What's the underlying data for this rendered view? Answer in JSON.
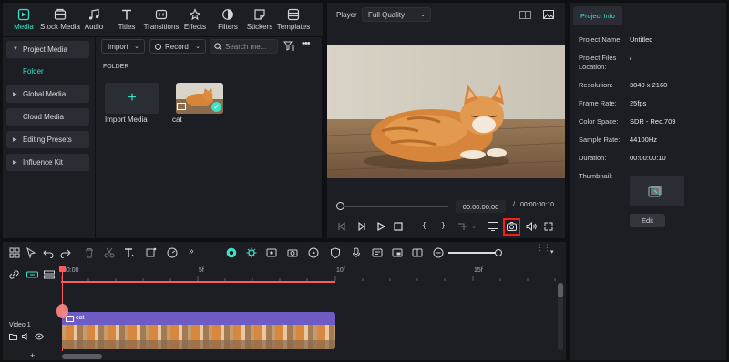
{
  "top_tabs": [
    {
      "label": "Media",
      "icon": "media-icon"
    },
    {
      "label": "Stock Media",
      "icon": "stock-media-icon"
    },
    {
      "label": "Audio",
      "icon": "music-note-icon"
    },
    {
      "label": "Titles",
      "icon": "titles-icon"
    },
    {
      "label": "Transitions",
      "icon": "transitions-icon"
    },
    {
      "label": "Effects",
      "icon": "effects-icon"
    },
    {
      "label": "Filters",
      "icon": "filters-icon"
    },
    {
      "label": "Stickers",
      "icon": "stickers-icon"
    },
    {
      "label": "Templates",
      "icon": "templates-icon"
    }
  ],
  "sidebar": {
    "items": [
      {
        "label": "Project Media"
      },
      {
        "label": "Folder"
      },
      {
        "label": "Global Media"
      },
      {
        "label": "Cloud Media"
      },
      {
        "label": "Editing Presets"
      },
      {
        "label": "Influence Kit"
      }
    ]
  },
  "media": {
    "import_label": "Import",
    "record_label": "Record",
    "search_placeholder": "Search me...",
    "folder_heading": "FOLDER",
    "import_tile_label": "Import Media",
    "clip_label": "cat"
  },
  "player": {
    "label": "Player",
    "quality": "Full Quality",
    "current_time": "00:00:00:00",
    "separator": "/",
    "total_time": "00:00:00:10",
    "progress": 0
  },
  "info": {
    "tab": "Project Info",
    "rows": [
      {
        "label": "Project Name:",
        "value": "Untitled"
      },
      {
        "label": "Project Files Location:",
        "value": "/"
      },
      {
        "label": "Resolution:",
        "value": "3840 x 2160"
      },
      {
        "label": "Frame Rate:",
        "value": "25fps"
      },
      {
        "label": "Color Space:",
        "value": "SDR - Rec.709"
      },
      {
        "label": "Sample Rate:",
        "value": "44100Hz"
      },
      {
        "label": "Duration:",
        "value": "00:00:00:10"
      },
      {
        "label": "Thumbnail:",
        "value": ""
      }
    ],
    "edit_label": "Edit"
  },
  "timeline": {
    "ruler": [
      "00:00",
      "5f",
      "10f",
      "15f"
    ],
    "track_label": "Video 1",
    "clip_label": "cat",
    "zoom_level": 0.7
  },
  "colors": {
    "accent": "#3fe0c5",
    "clip": "#6f5bc4",
    "playhead": "#ff5a5a",
    "highlight": "#ff1a1a"
  }
}
